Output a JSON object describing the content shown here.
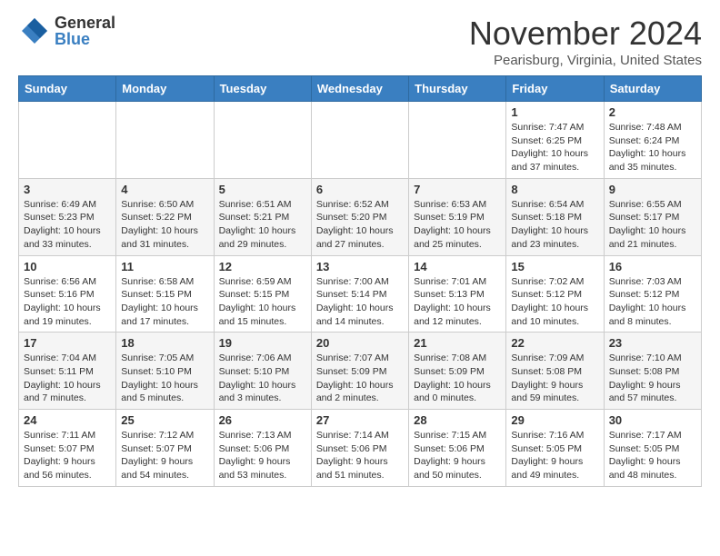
{
  "logo": {
    "general": "General",
    "blue": "Blue"
  },
  "header": {
    "month": "November 2024",
    "location": "Pearisburg, Virginia, United States"
  },
  "weekdays": [
    "Sunday",
    "Monday",
    "Tuesday",
    "Wednesday",
    "Thursday",
    "Friday",
    "Saturday"
  ],
  "weeks": [
    [
      {
        "day": "",
        "info": ""
      },
      {
        "day": "",
        "info": ""
      },
      {
        "day": "",
        "info": ""
      },
      {
        "day": "",
        "info": ""
      },
      {
        "day": "",
        "info": ""
      },
      {
        "day": "1",
        "info": "Sunrise: 7:47 AM\nSunset: 6:25 PM\nDaylight: 10 hours\nand 37 minutes."
      },
      {
        "day": "2",
        "info": "Sunrise: 7:48 AM\nSunset: 6:24 PM\nDaylight: 10 hours\nand 35 minutes."
      }
    ],
    [
      {
        "day": "3",
        "info": "Sunrise: 6:49 AM\nSunset: 5:23 PM\nDaylight: 10 hours\nand 33 minutes."
      },
      {
        "day": "4",
        "info": "Sunrise: 6:50 AM\nSunset: 5:22 PM\nDaylight: 10 hours\nand 31 minutes."
      },
      {
        "day": "5",
        "info": "Sunrise: 6:51 AM\nSunset: 5:21 PM\nDaylight: 10 hours\nand 29 minutes."
      },
      {
        "day": "6",
        "info": "Sunrise: 6:52 AM\nSunset: 5:20 PM\nDaylight: 10 hours\nand 27 minutes."
      },
      {
        "day": "7",
        "info": "Sunrise: 6:53 AM\nSunset: 5:19 PM\nDaylight: 10 hours\nand 25 minutes."
      },
      {
        "day": "8",
        "info": "Sunrise: 6:54 AM\nSunset: 5:18 PM\nDaylight: 10 hours\nand 23 minutes."
      },
      {
        "day": "9",
        "info": "Sunrise: 6:55 AM\nSunset: 5:17 PM\nDaylight: 10 hours\nand 21 minutes."
      }
    ],
    [
      {
        "day": "10",
        "info": "Sunrise: 6:56 AM\nSunset: 5:16 PM\nDaylight: 10 hours\nand 19 minutes."
      },
      {
        "day": "11",
        "info": "Sunrise: 6:58 AM\nSunset: 5:15 PM\nDaylight: 10 hours\nand 17 minutes."
      },
      {
        "day": "12",
        "info": "Sunrise: 6:59 AM\nSunset: 5:15 PM\nDaylight: 10 hours\nand 15 minutes."
      },
      {
        "day": "13",
        "info": "Sunrise: 7:00 AM\nSunset: 5:14 PM\nDaylight: 10 hours\nand 14 minutes."
      },
      {
        "day": "14",
        "info": "Sunrise: 7:01 AM\nSunset: 5:13 PM\nDaylight: 10 hours\nand 12 minutes."
      },
      {
        "day": "15",
        "info": "Sunrise: 7:02 AM\nSunset: 5:12 PM\nDaylight: 10 hours\nand 10 minutes."
      },
      {
        "day": "16",
        "info": "Sunrise: 7:03 AM\nSunset: 5:12 PM\nDaylight: 10 hours\nand 8 minutes."
      }
    ],
    [
      {
        "day": "17",
        "info": "Sunrise: 7:04 AM\nSunset: 5:11 PM\nDaylight: 10 hours\nand 7 minutes."
      },
      {
        "day": "18",
        "info": "Sunrise: 7:05 AM\nSunset: 5:10 PM\nDaylight: 10 hours\nand 5 minutes."
      },
      {
        "day": "19",
        "info": "Sunrise: 7:06 AM\nSunset: 5:10 PM\nDaylight: 10 hours\nand 3 minutes."
      },
      {
        "day": "20",
        "info": "Sunrise: 7:07 AM\nSunset: 5:09 PM\nDaylight: 10 hours\nand 2 minutes."
      },
      {
        "day": "21",
        "info": "Sunrise: 7:08 AM\nSunset: 5:09 PM\nDaylight: 10 hours\nand 0 minutes."
      },
      {
        "day": "22",
        "info": "Sunrise: 7:09 AM\nSunset: 5:08 PM\nDaylight: 9 hours\nand 59 minutes."
      },
      {
        "day": "23",
        "info": "Sunrise: 7:10 AM\nSunset: 5:08 PM\nDaylight: 9 hours\nand 57 minutes."
      }
    ],
    [
      {
        "day": "24",
        "info": "Sunrise: 7:11 AM\nSunset: 5:07 PM\nDaylight: 9 hours\nand 56 minutes."
      },
      {
        "day": "25",
        "info": "Sunrise: 7:12 AM\nSunset: 5:07 PM\nDaylight: 9 hours\nand 54 minutes."
      },
      {
        "day": "26",
        "info": "Sunrise: 7:13 AM\nSunset: 5:06 PM\nDaylight: 9 hours\nand 53 minutes."
      },
      {
        "day": "27",
        "info": "Sunrise: 7:14 AM\nSunset: 5:06 PM\nDaylight: 9 hours\nand 51 minutes."
      },
      {
        "day": "28",
        "info": "Sunrise: 7:15 AM\nSunset: 5:06 PM\nDaylight: 9 hours\nand 50 minutes."
      },
      {
        "day": "29",
        "info": "Sunrise: 7:16 AM\nSunset: 5:05 PM\nDaylight: 9 hours\nand 49 minutes."
      },
      {
        "day": "30",
        "info": "Sunrise: 7:17 AM\nSunset: 5:05 PM\nDaylight: 9 hours\nand 48 minutes."
      }
    ]
  ]
}
